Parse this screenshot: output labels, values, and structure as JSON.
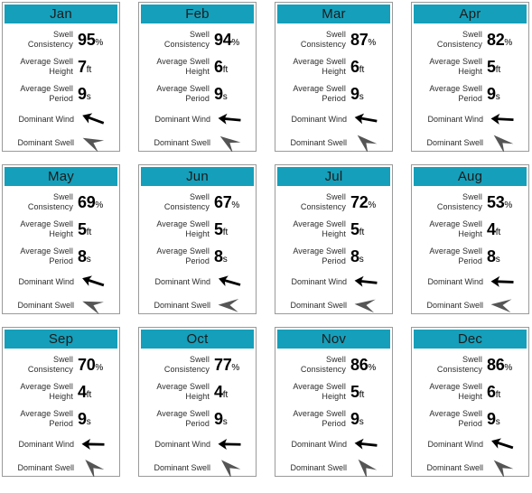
{
  "labels": {
    "swell_consistency": "Swell Consistency",
    "average_swell_height": "Average Swell Height",
    "average_swell_period": "Average Swell Period",
    "dominant_wind": "Dominant Wind",
    "dominant_swell": "Dominant Swell"
  },
  "units": {
    "consistency": "%",
    "height": "ft",
    "period": "s"
  },
  "colors": {
    "header_background": "#159fba",
    "header_text": "#1c1c1c",
    "card_border": "#9a9a9a",
    "label_text": "#2b2b2b",
    "value_text": "#000000",
    "wind_arrow": "#000000",
    "swell_arrow": "#555555",
    "page_background": "#ffffff"
  },
  "icons": {
    "wind": "wind-direction-arrow-icon",
    "swell": "swell-direction-arrow-icon"
  },
  "months": [
    {
      "name": "Jan",
      "swell_consistency": "95",
      "average_swell_height": "7",
      "average_swell_period": "9",
      "dominant_wind_deg": 200,
      "dominant_swell_deg": 205
    },
    {
      "name": "Feb",
      "swell_consistency": "94",
      "average_swell_height": "6",
      "average_swell_period": "9",
      "dominant_wind_deg": 185,
      "dominant_swell_deg": 215
    },
    {
      "name": "Mar",
      "swell_consistency": "87",
      "average_swell_height": "6",
      "average_swell_period": "9",
      "dominant_wind_deg": 190,
      "dominant_swell_deg": 222
    },
    {
      "name": "Apr",
      "swell_consistency": "82",
      "average_swell_height": "5",
      "average_swell_period": "9",
      "dominant_wind_deg": 183,
      "dominant_swell_deg": 222
    },
    {
      "name": "May",
      "swell_consistency": "69",
      "average_swell_height": "5",
      "average_swell_period": "8",
      "dominant_wind_deg": 198,
      "dominant_swell_deg": 200
    },
    {
      "name": "Jun",
      "swell_consistency": "67",
      "average_swell_height": "5",
      "average_swell_period": "8",
      "dominant_wind_deg": 196,
      "dominant_swell_deg": 182
    },
    {
      "name": "Jul",
      "swell_consistency": "72",
      "average_swell_height": "5",
      "average_swell_period": "8",
      "dominant_wind_deg": 186,
      "dominant_swell_deg": 186
    },
    {
      "name": "Aug",
      "swell_consistency": "53",
      "average_swell_height": "4",
      "average_swell_period": "8",
      "dominant_wind_deg": 182,
      "dominant_swell_deg": 184
    },
    {
      "name": "Sep",
      "swell_consistency": "70",
      "average_swell_height": "4",
      "average_swell_period": "9",
      "dominant_wind_deg": 181,
      "dominant_swell_deg": 226
    },
    {
      "name": "Oct",
      "swell_consistency": "77",
      "average_swell_height": "4",
      "average_swell_period": "9",
      "dominant_wind_deg": 181,
      "dominant_swell_deg": 224
    },
    {
      "name": "Nov",
      "swell_consistency": "86",
      "average_swell_height": "5",
      "average_swell_period": "9",
      "dominant_wind_deg": 186,
      "dominant_swell_deg": 228
    },
    {
      "name": "Dec",
      "swell_consistency": "86",
      "average_swell_height": "6",
      "average_swell_period": "9",
      "dominant_wind_deg": 198,
      "dominant_swell_deg": 222
    }
  ]
}
